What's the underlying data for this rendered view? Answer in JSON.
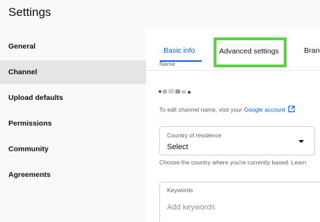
{
  "header": {
    "title": "Settings"
  },
  "sidebar": {
    "items": [
      {
        "label": "General",
        "active": false
      },
      {
        "label": "Channel",
        "active": true
      },
      {
        "label": "Upload defaults",
        "active": false
      },
      {
        "label": "Permissions",
        "active": false
      },
      {
        "label": "Community",
        "active": false
      },
      {
        "label": "Agreements",
        "active": false
      }
    ]
  },
  "tabs": {
    "basic_info": "Basic info",
    "advanced_settings": "Advanced settings",
    "branding": "Brand"
  },
  "basic_info": {
    "name_label": "Name",
    "edit_prefix": "To edit channel name, visit your ",
    "edit_link": "Google account",
    "country": {
      "label": "Country of residence",
      "value": "Select",
      "help": "Choose the country where you're currently based. Learn"
    },
    "keywords": {
      "label": "Keywords",
      "placeholder": "Add keywords"
    }
  },
  "colors": {
    "accent": "#065fd4",
    "highlight": "#5ad143",
    "active_nav": "#e5e5e5",
    "panel_bg": "#f9f9f9"
  },
  "icons": {
    "external_link": "open-in-new-icon",
    "dropdown": "caret-down-icon"
  }
}
